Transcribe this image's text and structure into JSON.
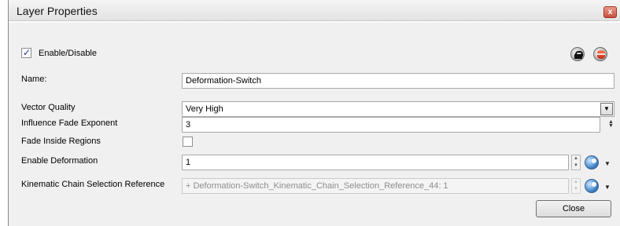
{
  "window": {
    "title": "Layer Properties",
    "close_glyph": "x"
  },
  "enable": {
    "label": "Enable/Disable",
    "checked": true
  },
  "header_icons": [
    "lock-icon",
    "database-icon"
  ],
  "fields": {
    "name": {
      "label": "Name:",
      "value": "Deformation-Switch"
    },
    "vector_quality": {
      "label": "Vector Quality",
      "value": "Very High"
    },
    "influence_fade_exponent": {
      "label": "Influence Fade Exponent",
      "value": "3"
    },
    "fade_inside_regions": {
      "label": "Fade Inside Regions",
      "checked": false
    },
    "enable_deformation": {
      "label": "Enable Deformation",
      "value": "1"
    },
    "kinematic_chain": {
      "label": "Kinematic Chain Selection Reference",
      "value": "+ Deformation-Switch_Kinematic_Chain_Selection_Reference_44: 1"
    }
  },
  "buttons": {
    "close_label": "Close"
  },
  "colors": {
    "title_close": "#c7503d",
    "check_mark": "#2b3c83",
    "link_icon": "#3b7fc7"
  }
}
